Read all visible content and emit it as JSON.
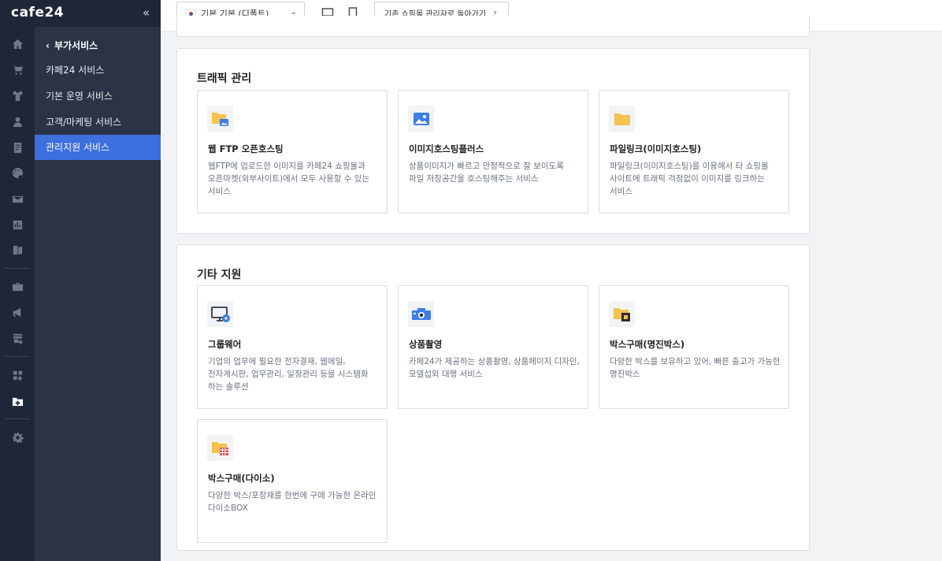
{
  "app": {
    "logo": "cafe24",
    "collapse_glyph": "«"
  },
  "rail": {
    "icons": [
      "home-icon",
      "cart-icon",
      "shirt-icon",
      "person-icon",
      "board-icon",
      "palette-icon",
      "megaphone-mail-icon",
      "stats-icon",
      "book-icon",
      "briefcase-icon",
      "loudspeaker-icon",
      "store-add-icon",
      "apps-add-icon",
      "folder-add-icon",
      "gear-icon"
    ],
    "active": "folder-add-icon"
  },
  "submenu": {
    "title": "부가서비스",
    "items": [
      "카페24 서비스",
      "기본 운영 서비스",
      "고객/마케팅 서비스",
      "관리지원 서비스"
    ],
    "active_index": 3
  },
  "topbar": {
    "shop_select": "기본 기본 (디폴트)",
    "back_button": "기존 쇼핑몰 관리자로 돌아가기",
    "back_arrow": "›"
  },
  "sections": {
    "traffic": {
      "title": "트래픽 관리",
      "cards": [
        {
          "title": "웹 FTP 오픈호스팅",
          "desc": "웹FTP에 업로드한 이미지를 카페24 쇼핑몰과 오픈마켓(외부사이트)에서 모두 사용할 수 있는 서비스"
        },
        {
          "title": "이미지호스팅플러스",
          "desc": "상품이미지가 빠르고 안정적으로 잘 보이도록 파일 저장공간을 호스팅해주는 서비스"
        },
        {
          "title": "파일링크(이미지호스팅)",
          "desc": "파일링크(이미지호스팅)를 이용해서 타 쇼핑몰 사이트에 트래픽 걱정없이 이미지를 링크하는 서비스"
        }
      ]
    },
    "etc": {
      "title": "기타 지원",
      "cards": [
        {
          "title": "그룹웨어",
          "desc": "기업의 업무에 필요한 전자결재, 웹메일, 전자게시판, 업무관리, 일정관리 등을 시스템화 하는 솔루션"
        },
        {
          "title": "상품촬영",
          "desc": "카페24가 제공하는 상품촬영, 상품페이지 디자인, 모델섭외 대행 서비스"
        },
        {
          "title": "박스구매(명진박스)",
          "desc": "다양한 박스를 보유하고 있어, 빠른 출고가 가능한 명진박스"
        },
        {
          "title": "박스구매(다이소)",
          "desc": "다양한 박스/포장재를 한번에 구매 가능한 온라인 다이소BOX"
        }
      ]
    }
  },
  "colors": {
    "accent": "#3d6fe0",
    "rail": "#1f2637",
    "submenu": "#2b3346",
    "folder": "#f3c24f",
    "blue": "#3d7ee8"
  }
}
